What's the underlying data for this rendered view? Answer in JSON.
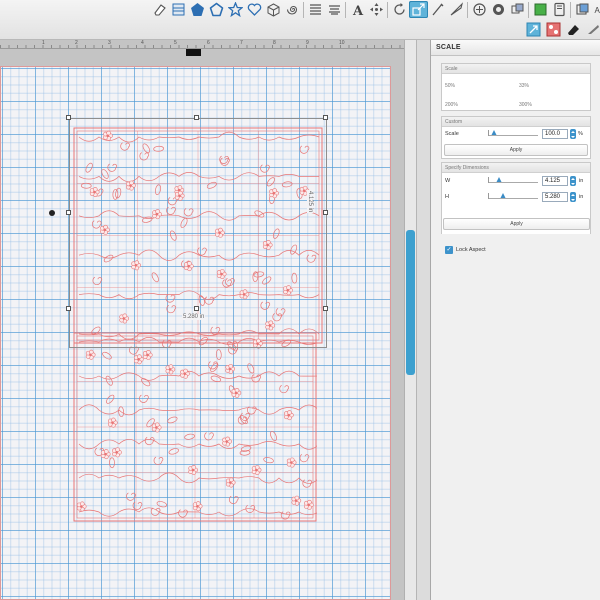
{
  "toolbar": {
    "tools": [
      "eraser-tool-icon",
      "fill-pattern-icon",
      "pentagon-icon",
      "rounded-pentagon-icon",
      "star-icon",
      "heart-icon",
      "cube-icon",
      "spiral-icon",
      "align-left-icon",
      "align-center-icon",
      "text-icon",
      "move-icon",
      "rotate-icon",
      "scale-icon",
      "line-tool-icon",
      "knife-icon",
      "trace-icon",
      "offset-icon",
      "replicate-icon",
      "fill-color-icon",
      "page-icon",
      "layers-icon",
      "character-style-icon",
      "lines-icon"
    ],
    "text_tool_label": "A",
    "char_style_label": "A|b",
    "accent": "#5fb3d9",
    "second_row_tools": [
      "scale-window-icon",
      "pattern-icon",
      "eraser-icon",
      "knife-blade-icon"
    ]
  },
  "panel": {
    "title": "SCALE",
    "scale_section": {
      "title": "Scale",
      "presets": [
        "50%",
        "33%",
        "200%",
        "300%"
      ]
    },
    "custom_section": {
      "title": "Custom",
      "scale_label": "Scale",
      "scale_value": "100.0",
      "scale_unit": "%",
      "slider_fraction": 0.1,
      "apply_label": "Apply"
    },
    "dimensions_section": {
      "title": "Specify Dimensions",
      "w_label": "W",
      "w_value": "4.125",
      "w_unit": "in",
      "w_fraction": 0.2,
      "h_label": "H",
      "h_value": "5.280",
      "h_unit": "in",
      "h_fraction": 0.27,
      "lock_label": "Lock Aspect",
      "lock_checked": true,
      "apply_label": "Apply"
    }
  },
  "canvas": {
    "selection_width": "5.280 in",
    "selection_height": "4.125 in",
    "ruler_labels": [
      "1",
      "2",
      "3",
      "4",
      "5",
      "6",
      "7",
      "8",
      "9",
      "10"
    ],
    "design_color": "#e87575",
    "grid_color": "#4696d2"
  }
}
